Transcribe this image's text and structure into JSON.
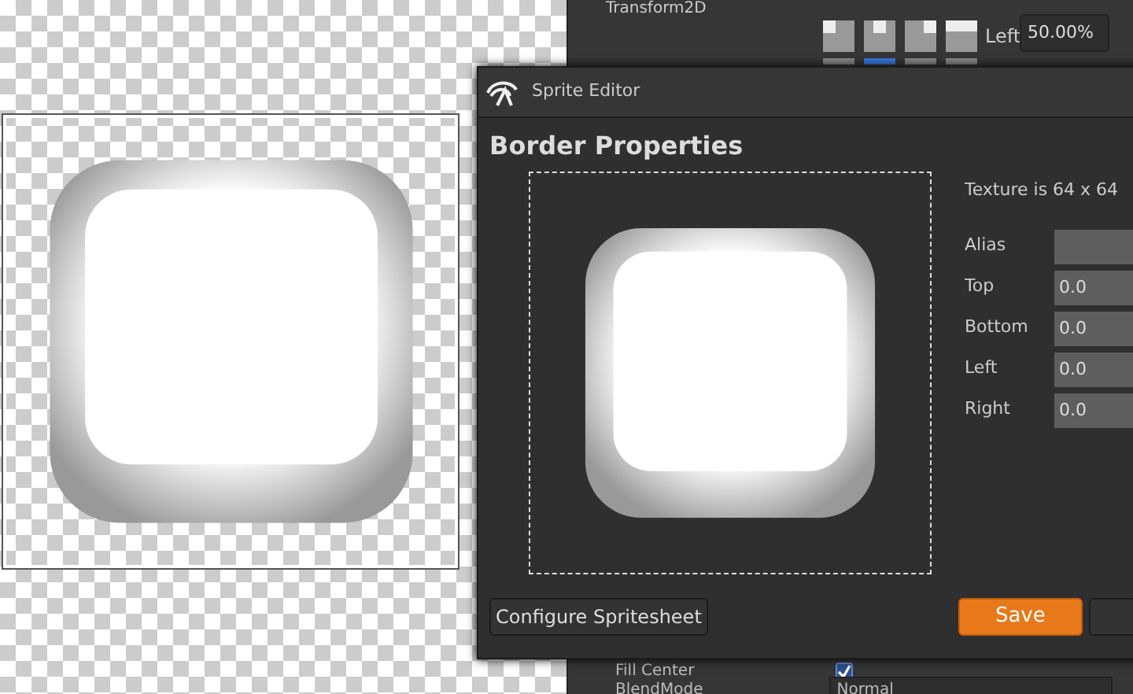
{
  "back_panel": {
    "section": "Transform2D",
    "anchors": [
      {
        "kind": "left",
        "selected": false
      },
      {
        "kind": "center",
        "selected": true
      },
      {
        "kind": "right",
        "selected": false
      },
      {
        "kind": "stretch",
        "selected": false
      }
    ],
    "left_label": "Left",
    "left_value": "50.00%",
    "fill_center": {
      "label": "Fill Center",
      "checked": true
    },
    "blend_mode": {
      "label": "BlendMode",
      "value": "Normal"
    }
  },
  "dialog": {
    "title": "Sprite Editor",
    "heading": "Border Properties",
    "texture_info": "Texture is 64 x 64",
    "fields": [
      {
        "label": "Alias"
      },
      {
        "label": "Top",
        "value": "0.0"
      },
      {
        "label": "Bottom",
        "value": "0.0"
      },
      {
        "label": "Left",
        "value": "0.0"
      },
      {
        "label": "Right",
        "value": "0.0"
      }
    ],
    "buttons": [
      {
        "kind": "secondary",
        "label": "Configure Spritesheet"
      },
      {
        "kind": "primary",
        "label": "Save"
      },
      {
        "kind": "cut"
      }
    ]
  }
}
